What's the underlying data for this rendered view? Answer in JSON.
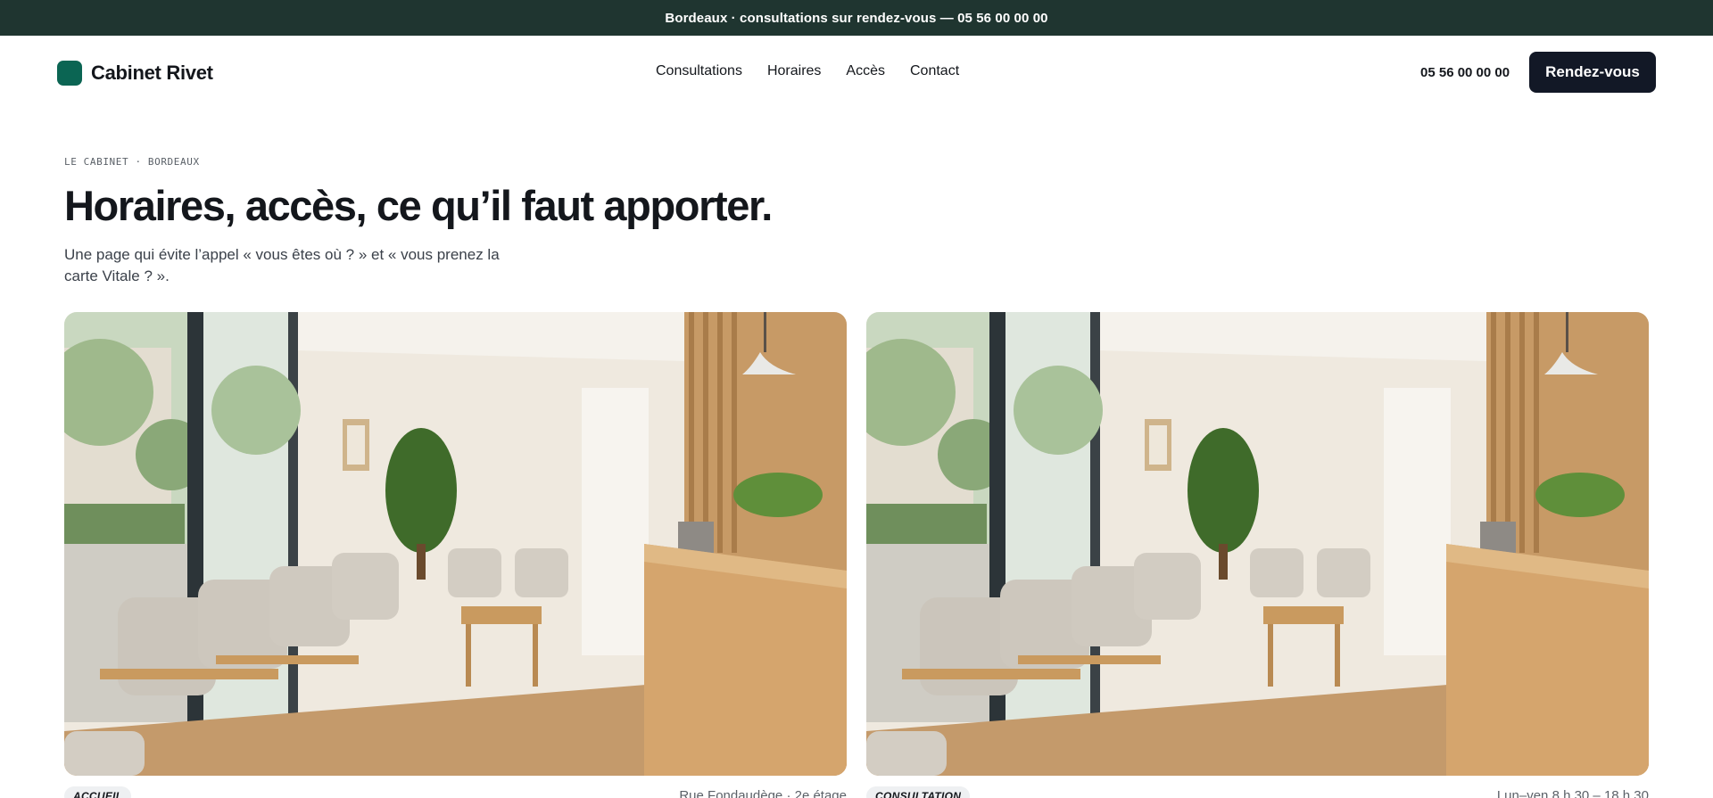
{
  "topbar": {
    "text": "Bordeaux · consultations sur rendez-vous — 05 56 00 00 00"
  },
  "header": {
    "brand": "Cabinet Rivet",
    "nav": [
      "Consultations",
      "Horaires",
      "Accès",
      "Contact"
    ],
    "phone": "05 56 00 00 00",
    "cta_label": "Rendez-vous"
  },
  "hero": {
    "eyebrow": "LE CABINET · BORDEAUX",
    "title": "Horaires, accès, ce qu’il faut apporter.",
    "lede": "Une page qui évite l’appel « vous êtes où ? » et « vous prenez la carte Vitale ? »."
  },
  "cards": [
    {
      "tag": "ACCUEIL",
      "caption": "Rue Fondaudège · 2e étage"
    },
    {
      "tag": "CONSULTATION",
      "caption": "Lun–ven 8 h 30 – 18 h 30"
    }
  ],
  "colors": {
    "topbar_bg": "#1f3530",
    "brand_accent": "#0b6553",
    "cta_bg": "#121826"
  }
}
